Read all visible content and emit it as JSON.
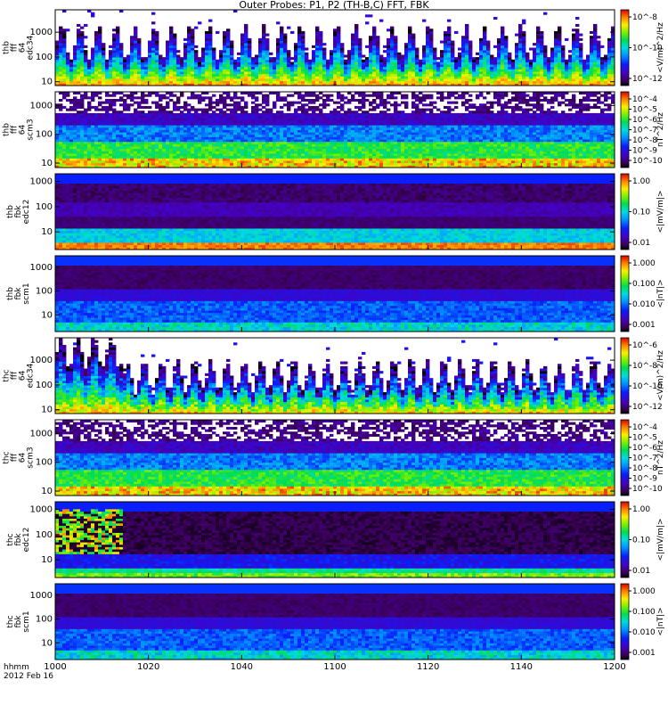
{
  "title": "Outer Probes: P1, P2 (TH-B,C) FFT, FBK",
  "footer": {
    "time_label": "hhmm",
    "date_label": "2012 Feb 16"
  },
  "chart_data": {
    "type": "heatmap",
    "x_ticks": [
      "1000",
      "1020",
      "1040",
      "1100",
      "1120",
      "1140",
      "1200"
    ],
    "panels": [
      {
        "ylabel": [
          "thb",
          "fff",
          "64",
          "edc34"
        ],
        "y_ticks": [
          "10",
          "100",
          "1000"
        ],
        "y_range": [
          7,
          8000
        ],
        "kind": "fft_e",
        "colorbar_unit": "<V/m)^2/Hz",
        "colorbar_ticks": [
          "10^-8",
          "10^-10",
          "10^-12"
        ]
      },
      {
        "ylabel": [
          "thb",
          "fff",
          "64",
          "scm3"
        ],
        "y_ticks": [
          "10",
          "100",
          "1000"
        ],
        "y_range": [
          7,
          3000
        ],
        "kind": "fft_b",
        "colorbar_unit": "nT^2/Hz",
        "colorbar_ticks": [
          "10^-4",
          "10^-5",
          "10^-6",
          "10^-7",
          "10^-8",
          "10^-9",
          "10^-10"
        ]
      },
      {
        "ylabel": [
          "thb",
          "fbk",
          "edc12"
        ],
        "y_ticks": [
          "10",
          "100",
          "1000"
        ],
        "y_range": [
          2,
          2000
        ],
        "kind": "fbk_e",
        "colorbar_unit": "<|mV/m|>",
        "colorbar_ticks": [
          "1.00",
          "0.10",
          "0.01"
        ]
      },
      {
        "ylabel": [
          "thb",
          "fbk",
          "scm1"
        ],
        "y_ticks": [
          "10",
          "100",
          "1000"
        ],
        "y_range": [
          2,
          3000
        ],
        "kind": "fbk_b",
        "colorbar_unit": "<|nT|>",
        "colorbar_ticks": [
          "1.000",
          "0.100",
          "0.010",
          "0.001"
        ]
      },
      {
        "ylabel": [
          "thc",
          "fff",
          "64",
          "edc34"
        ],
        "y_ticks": [
          "10",
          "100",
          "1000"
        ],
        "y_range": [
          7,
          8000
        ],
        "kind": "fft_e2",
        "colorbar_unit": "<V/m)^2/Hz",
        "colorbar_ticks": [
          "10^-6",
          "10^-8",
          "10^-10",
          "10^-12"
        ]
      },
      {
        "ylabel": [
          "thc",
          "fff",
          "64",
          "scm3"
        ],
        "y_ticks": [
          "10",
          "100",
          "1000"
        ],
        "y_range": [
          7,
          3000
        ],
        "kind": "fft_b",
        "colorbar_unit": "nT^2/Hz",
        "colorbar_ticks": [
          "10^-4",
          "10^-5",
          "10^-6",
          "10^-7",
          "10^-8",
          "10^-9",
          "10^-10"
        ]
      },
      {
        "ylabel": [
          "thc",
          "fbk",
          "edc12"
        ],
        "y_ticks": [
          "10",
          "100",
          "1000"
        ],
        "y_range": [
          2,
          2000
        ],
        "kind": "fbk_e2",
        "colorbar_unit": "<|mV/m|>",
        "colorbar_ticks": [
          "1.00",
          "0.10",
          "0.01"
        ]
      },
      {
        "ylabel": [
          "thc",
          "fbk",
          "scm1"
        ],
        "y_ticks": [
          "10",
          "100",
          "1000"
        ],
        "y_range": [
          2,
          3000
        ],
        "kind": "fbk_b",
        "colorbar_unit": "<|nT|>",
        "colorbar_ticks": [
          "1.000",
          "0.100",
          "0.010",
          "0.001"
        ]
      }
    ]
  }
}
